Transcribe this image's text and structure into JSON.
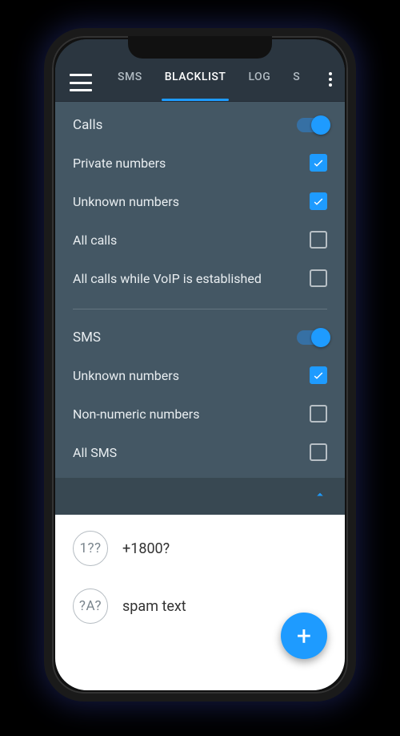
{
  "tabs": {
    "sms": "SMS",
    "blacklist": "BLACKLIST",
    "log": "LOG",
    "more": "S"
  },
  "calls": {
    "header": "Calls",
    "private": "Private numbers",
    "unknown": "Unknown numbers",
    "all": "All calls",
    "voip": "All calls while VoIP is established"
  },
  "sms": {
    "header": "SMS",
    "unknown": "Unknown numbers",
    "nonnumeric": "Non-numeric numbers",
    "all": "All SMS"
  },
  "entries": [
    {
      "icon": "1??",
      "label": "+1800?"
    },
    {
      "icon": "?A?",
      "label": "spam text"
    }
  ],
  "state": {
    "calls_toggle": true,
    "calls_private": true,
    "calls_unknown": true,
    "calls_all": false,
    "calls_voip": false,
    "sms_toggle": true,
    "sms_unknown": true,
    "sms_nonnumeric": false,
    "sms_all": false
  },
  "colors": {
    "accent": "#1e9bff"
  }
}
